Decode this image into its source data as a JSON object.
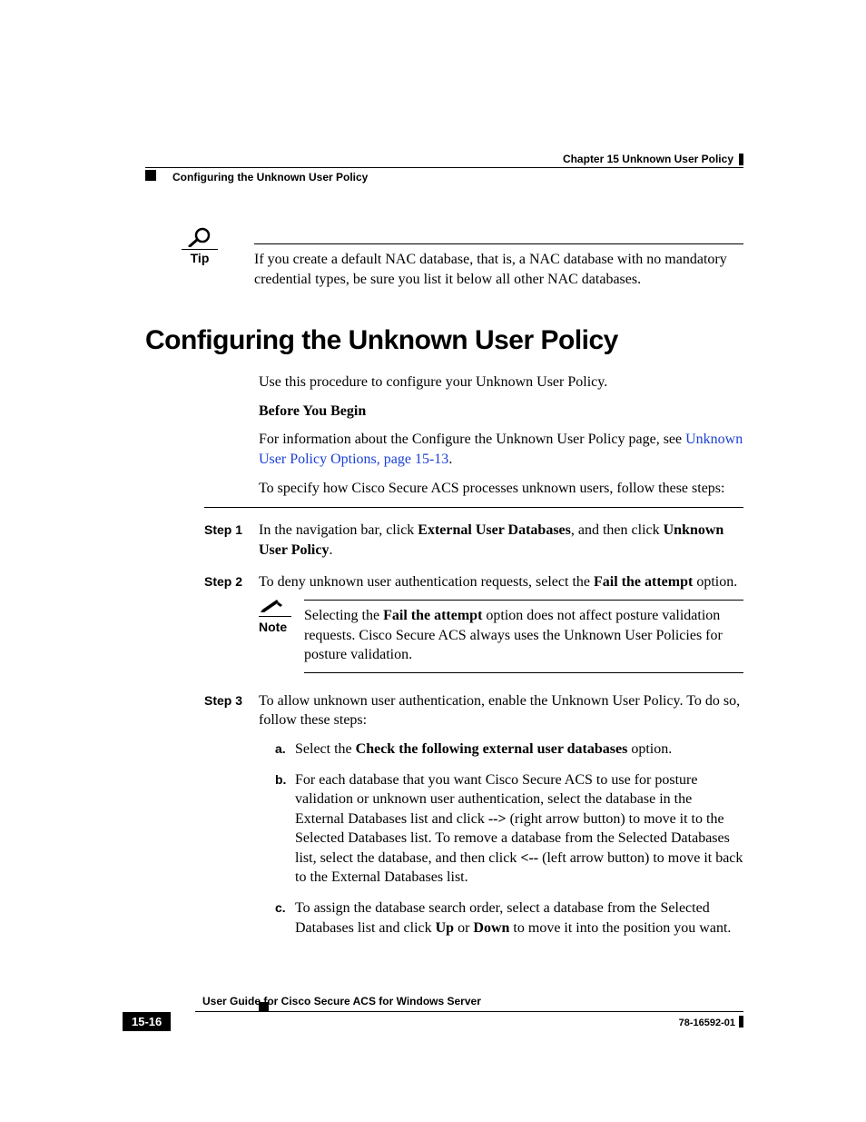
{
  "header": {
    "chapter": "Chapter 15    Unknown User Policy",
    "section": "Configuring the Unknown User Policy"
  },
  "tip": {
    "label": "Tip",
    "text": "If you create a default NAC database, that is, a NAC database with no mandatory credential types, be sure you list it below all other NAC databases."
  },
  "heading": "Configuring the Unknown User Policy",
  "intro": "Use this procedure to configure your Unknown User Policy.",
  "before_label": "Before You Begin",
  "before_text_pre": "For information about the Configure the Unknown User Policy page, see ",
  "before_link": "Unknown User Policy Options, page 15-13",
  "before_text_post": ".",
  "specify": "To specify how Cisco Secure ACS processes unknown users, follow these steps:",
  "steps": {
    "s1": {
      "label": "Step 1",
      "pre": "In the navigation bar, click ",
      "b1": "External User Databases",
      "mid": ", and then click ",
      "b2": "Unknown User Policy",
      "post": "."
    },
    "s2": {
      "label": "Step 2",
      "pre": "To deny unknown user authentication requests, select the ",
      "b1": "Fail the attempt",
      "post": " option."
    },
    "note": {
      "label": "Note",
      "pre": "Selecting the ",
      "b1": "Fail the attempt",
      "post": " option does not affect posture validation requests. Cisco Secure ACS always uses the Unknown User Policies for posture validation."
    },
    "s3": {
      "label": "Step 3",
      "text": "To allow unknown user authentication, enable the Unknown User Policy. To do so, follow these steps:"
    },
    "sub": {
      "a": {
        "letter": "a.",
        "pre": "Select the ",
        "b1": "Check the following external user databases",
        "post": " option."
      },
      "b": {
        "letter": "b.",
        "pre": "For each database that you want Cisco Secure ACS to use for posture validation or unknown user authentication, select the database in the External Databases list and click ",
        "b1": "-->",
        "mid": " (right arrow button) to move it to the Selected Databases list. To remove a database from the Selected Databases list, select the database, and then click ",
        "b2": "<--",
        "post": " (left arrow button) to move it back to the External Databases list."
      },
      "c": {
        "letter": "c.",
        "pre": "To assign the database search order, select a database from the Selected Databases list and click ",
        "b1": "Up",
        "mid": " or ",
        "b2": "Down",
        "post": " to move it into the position you want."
      }
    }
  },
  "footer": {
    "title": "User Guide for Cisco Secure ACS for Windows Server",
    "page": "15-16",
    "docnum": "78-16592-01"
  }
}
